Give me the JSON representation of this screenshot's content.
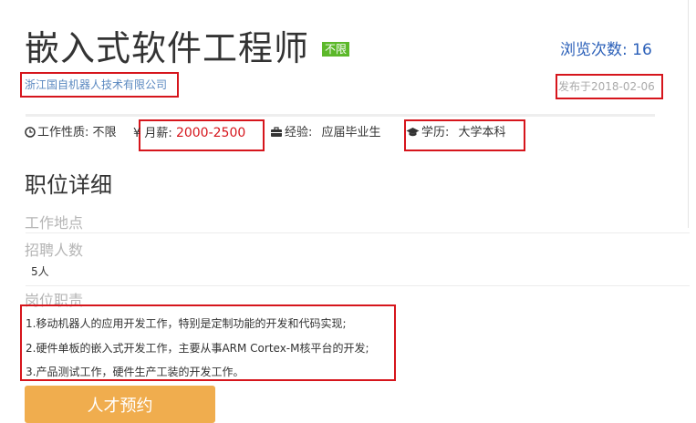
{
  "job": {
    "title": "嵌入式软件工程师",
    "badge": "不限",
    "views": "浏览次数: 16",
    "company": "浙江国自机器人技术有限公司",
    "published": "发布于2018-02-06"
  },
  "info": {
    "nature_label": "工作性质:",
    "nature_value": "不限",
    "salary_symbol": "¥",
    "salary_label": "月薪:",
    "salary_value": "2000-2500",
    "experience_label": "经验:",
    "experience_value": "应届毕业生",
    "education_label": "学历:",
    "education_value": "大学本科"
  },
  "details": {
    "heading": "职位详细",
    "location_label": "工作地点",
    "headcount_label": "招聘人数",
    "headcount_value": "5人",
    "duties_label": "岗位职责",
    "duties": [
      "1.移动机器人的应用开发工作，特别是定制功能的开发和代码实现;",
      "2.硬件单板的嵌入式开发工作，主要从事ARM Cortex-M核平台的开发;",
      "3.产品测试工作，硬件生产工装的开发工作。"
    ]
  },
  "actions": {
    "reserve": "人才预约"
  },
  "colors": {
    "highlight": "#d6151c",
    "button": "#f0ad4e",
    "badge": "#5cb82a",
    "link": "#2a5fb8"
  },
  "icons": [
    "clock-icon",
    "yen-icon",
    "briefcase-icon",
    "graduation-cap-icon"
  ]
}
